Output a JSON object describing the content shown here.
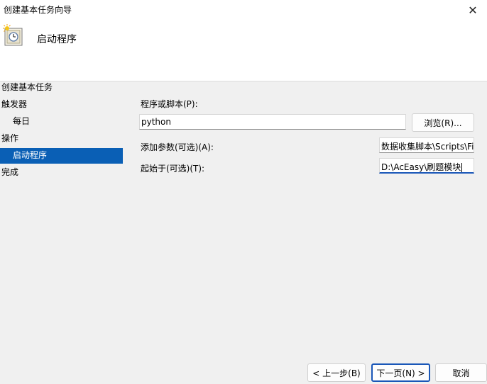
{
  "window": {
    "title": "创建基本任务向导"
  },
  "header": {
    "title": "启动程序",
    "icon": "task-clock-icon"
  },
  "steps": [
    {
      "label": "创建基本任务",
      "active": false
    },
    {
      "label": "触发器",
      "active": false
    },
    {
      "label": "每日",
      "active": false
    },
    {
      "label": "操作",
      "active": false
    },
    {
      "label": "启动程序",
      "active": true
    },
    {
      "label": "完成",
      "active": false
    }
  ],
  "form": {
    "program_label": "程序或脚本(P):",
    "program_value": "python",
    "browse_label": "浏览(R)...",
    "args_label": "添加参数(可选)(A):",
    "args_value": "数据收集脚本\\Scripts\\Fi",
    "start_label": "起始于(可选)(T):",
    "start_value": "D:\\AcEasy\\刷题模块"
  },
  "footer": {
    "back_label": "< 上一步(B)",
    "next_label": "下一页(N) >",
    "cancel_label": "取消"
  },
  "colors": {
    "accent": "#0a5fb5",
    "focus_border": "#1a57b8",
    "background": "#f0f0f0"
  }
}
